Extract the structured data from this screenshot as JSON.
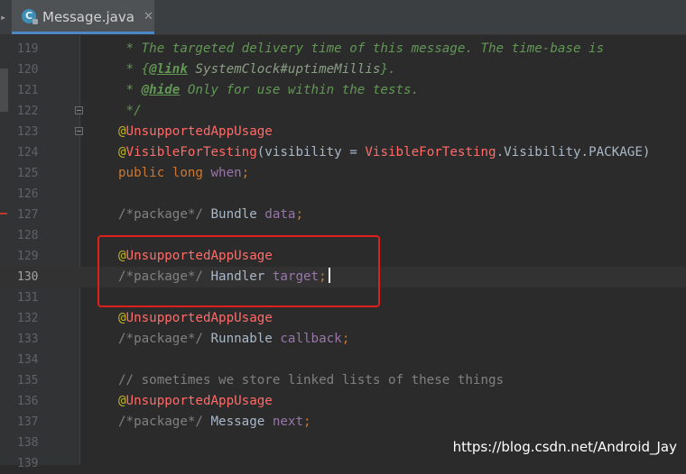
{
  "editor": {
    "tab": {
      "icon": "C",
      "title": "Message.java",
      "close": "✕"
    },
    "watermark": "https://blog.csdn.net/Android_Jay"
  },
  "lines": [
    {
      "num": "119",
      "t": [
        [
          "doc",
          " * The targeted delivery time of this message. The time-base is"
        ]
      ]
    },
    {
      "num": "120",
      "t": [
        [
          "doc",
          " * {"
        ],
        [
          "doctag",
          "@link"
        ],
        [
          "ref",
          " SystemClock#uptimeMillis"
        ],
        [
          "doc",
          "}."
        ]
      ]
    },
    {
      "num": "121",
      "t": [
        [
          "doc",
          " * "
        ],
        [
          "doctag",
          "@hide"
        ],
        [
          "doc",
          " Only for use within the tests."
        ]
      ]
    },
    {
      "num": "122",
      "fold": true,
      "t": [
        [
          "doc",
          " */"
        ]
      ]
    },
    {
      "num": "123",
      "fold": true,
      "t": [
        [
          "anno",
          "@"
        ],
        [
          "anno-name",
          "UnsupportedAppUsage"
        ]
      ]
    },
    {
      "num": "124",
      "t": [
        [
          "anno",
          "@"
        ],
        [
          "anno-name",
          "VisibleForTesting"
        ],
        [
          "plain",
          "(visibility = "
        ],
        [
          "anno-name",
          "VisibleForTesting"
        ],
        [
          "plain",
          ".Visibility.PACKAGE)"
        ]
      ]
    },
    {
      "num": "125",
      "t": [
        [
          "kw",
          "public long "
        ],
        [
          "field",
          "when"
        ],
        [
          "kw",
          ";"
        ]
      ]
    },
    {
      "num": "126",
      "t": []
    },
    {
      "num": "127",
      "t": [
        [
          "comment",
          "/*package*/ "
        ],
        [
          "plain",
          "Bundle "
        ],
        [
          "field",
          "data"
        ],
        [
          "kw",
          ";"
        ]
      ]
    },
    {
      "num": "128",
      "t": []
    },
    {
      "num": "129",
      "t": [
        [
          "anno",
          "@"
        ],
        [
          "anno-name",
          "UnsupportedAppUsage"
        ]
      ]
    },
    {
      "num": "130",
      "current": true,
      "t": [
        [
          "comment",
          "/*package*/ "
        ],
        [
          "plain",
          "Handler "
        ],
        [
          "field",
          "target"
        ],
        [
          "kw",
          ";"
        ]
      ]
    },
    {
      "num": "131",
      "t": []
    },
    {
      "num": "132",
      "t": [
        [
          "anno",
          "@"
        ],
        [
          "anno-name",
          "UnsupportedAppUsage"
        ]
      ]
    },
    {
      "num": "133",
      "t": [
        [
          "comment",
          "/*package*/ "
        ],
        [
          "plain",
          "Runnable "
        ],
        [
          "field",
          "callback"
        ],
        [
          "kw",
          ";"
        ]
      ]
    },
    {
      "num": "134",
      "t": []
    },
    {
      "num": "135",
      "t": [
        [
          "comment",
          "// sometimes we store linked lists of these things"
        ]
      ]
    },
    {
      "num": "136",
      "t": [
        [
          "anno",
          "@"
        ],
        [
          "anno-name",
          "UnsupportedAppUsage"
        ]
      ]
    },
    {
      "num": "137",
      "t": [
        [
          "comment",
          "/*package*/ "
        ],
        [
          "plain",
          "Message "
        ],
        [
          "field",
          "next"
        ],
        [
          "kw",
          ";"
        ]
      ]
    },
    {
      "num": "138",
      "t": []
    },
    {
      "num": "139",
      "t": []
    }
  ]
}
